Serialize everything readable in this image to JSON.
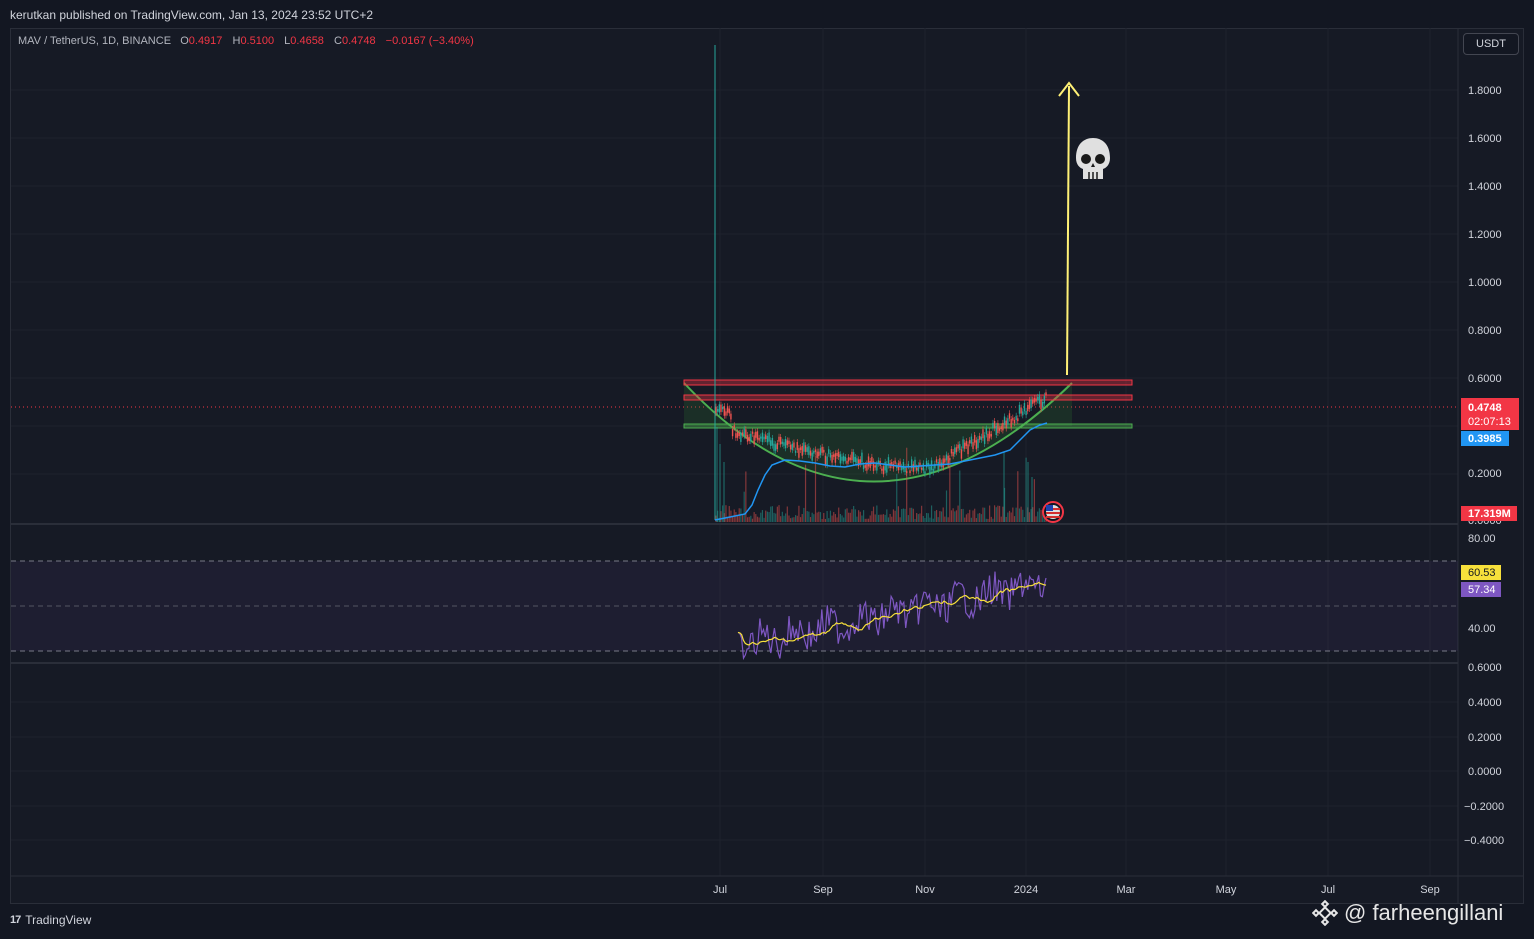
{
  "header": {
    "published": "kerutkan published on TradingView.com, Jan 13, 2024 23:52 UTC+2"
  },
  "legend": {
    "symbol": "MAV / TetherUS, 1D, BINANCE",
    "open_label": "O",
    "open": "0.4917",
    "high_label": "H",
    "high": "0.5100",
    "low_label": "L",
    "low": "0.4658",
    "close_label": "C",
    "close": "0.4748",
    "change": "−0.0167 (−3.40%)"
  },
  "currency_button": "USDT",
  "price_axis": {
    "ticks": [
      "1.8000",
      "1.6000",
      "1.4000",
      "1.2000",
      "1.0000",
      "0.8000",
      "0.6000",
      "0.2000"
    ],
    "partial_tick": "0.0000"
  },
  "price_labels": {
    "last_price": "0.4748",
    "countdown": "02:07:13",
    "ma_value": "0.3985",
    "volume": "17.319M"
  },
  "rsi_axis": {
    "ticks": [
      "80.00",
      "40.00"
    ],
    "rsi_value": "60.53",
    "rsi_ma_value": "57.34"
  },
  "lower_axis": {
    "ticks": [
      "0.6000",
      "0.4000",
      "0.2000",
      "0.0000",
      "−0.2000",
      "−0.4000"
    ]
  },
  "time_axis": {
    "labels": [
      "Jul",
      "Sep",
      "Nov",
      "2024",
      "Mar",
      "May",
      "Jul",
      "Sep"
    ]
  },
  "footer": {
    "brand": "TradingView",
    "brand_mark": "17",
    "watermark": "@ farheengillani"
  },
  "colors": {
    "background": "#161a25",
    "resistance": "#f23645",
    "support": "#4caf50",
    "arrow": "#fff176",
    "ma_line": "#2196f3",
    "rsi_line": "#7e57c2",
    "rsi_ma": "#f7e03b"
  },
  "icons": {
    "target_marker": "skull-icon",
    "event_marker": "us-flag-icon"
  }
}
